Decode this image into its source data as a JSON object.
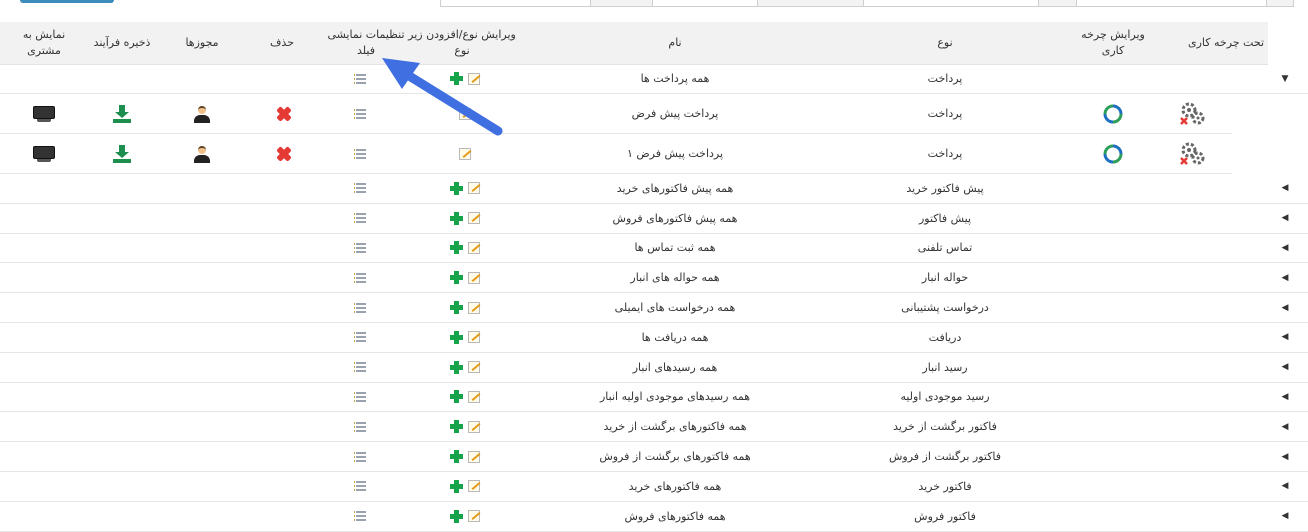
{
  "header": {
    "customer_display": "نمایش به مشتری",
    "save_process": "ذخیره فرآیند",
    "permissions": "مجوزها",
    "delete": "حذف",
    "field_display_settings": "تنظیمات نمایشی فیلد",
    "edit_type_add_subtype": "ویرایش نوع/افزودن زیر نوع",
    "name": "نام",
    "type": "نوع",
    "edit_workflow": "ویرایش چرخه کاری",
    "under_workflow": "تحت چرخه کاری"
  },
  "parent_row": {
    "type": "پرداخت",
    "name": "همه پرداخت ها",
    "expanded_icon": "caret-down-icon"
  },
  "child_rows": [
    {
      "type": "پرداخت",
      "name": "پرداخت پیش فرض"
    },
    {
      "type": "پرداخت",
      "name": "پرداخت پیش فرض ۱"
    }
  ],
  "rows": [
    {
      "type": "پیش فاکتور خرید",
      "name": "همه پیش فاکتورهای خرید"
    },
    {
      "type": "پیش فاکتور",
      "name": "همه پیش فاکتورهای فروش"
    },
    {
      "type": "تماس تلفنی",
      "name": "همه ثبت تماس ها"
    },
    {
      "type": "حواله انبار",
      "name": "همه حواله های انبار"
    },
    {
      "type": "درخواست پشتیبانی",
      "name": "همه درخواست های ایمیلی"
    },
    {
      "type": "دریافت",
      "name": "همه دریافت ها"
    },
    {
      "type": "رسید انبار",
      "name": "همه رسیدهای انبار"
    },
    {
      "type": "رسید موجودی اولیه",
      "name": "همه رسیدهای موجودی اولیه انبار"
    },
    {
      "type": "فاکتور برگشت از خرید",
      "name": "همه فاکتورهای برگشت از خرید"
    },
    {
      "type": "فاکتور برگشت از فروش",
      "name": "همه فاکتورهای برگشت از فروش"
    },
    {
      "type": "فاکتور خرید",
      "name": "همه فاکتورهای خرید"
    },
    {
      "type": "فاکتور فروش",
      "name": "همه فاکتورهای فروش"
    }
  ],
  "colors": {
    "header_bg": "#f2f2f2",
    "accent_blue": "#3c8dbc",
    "arrow": "#3f6fe0",
    "green": "#16a34a",
    "red": "#e53935"
  }
}
